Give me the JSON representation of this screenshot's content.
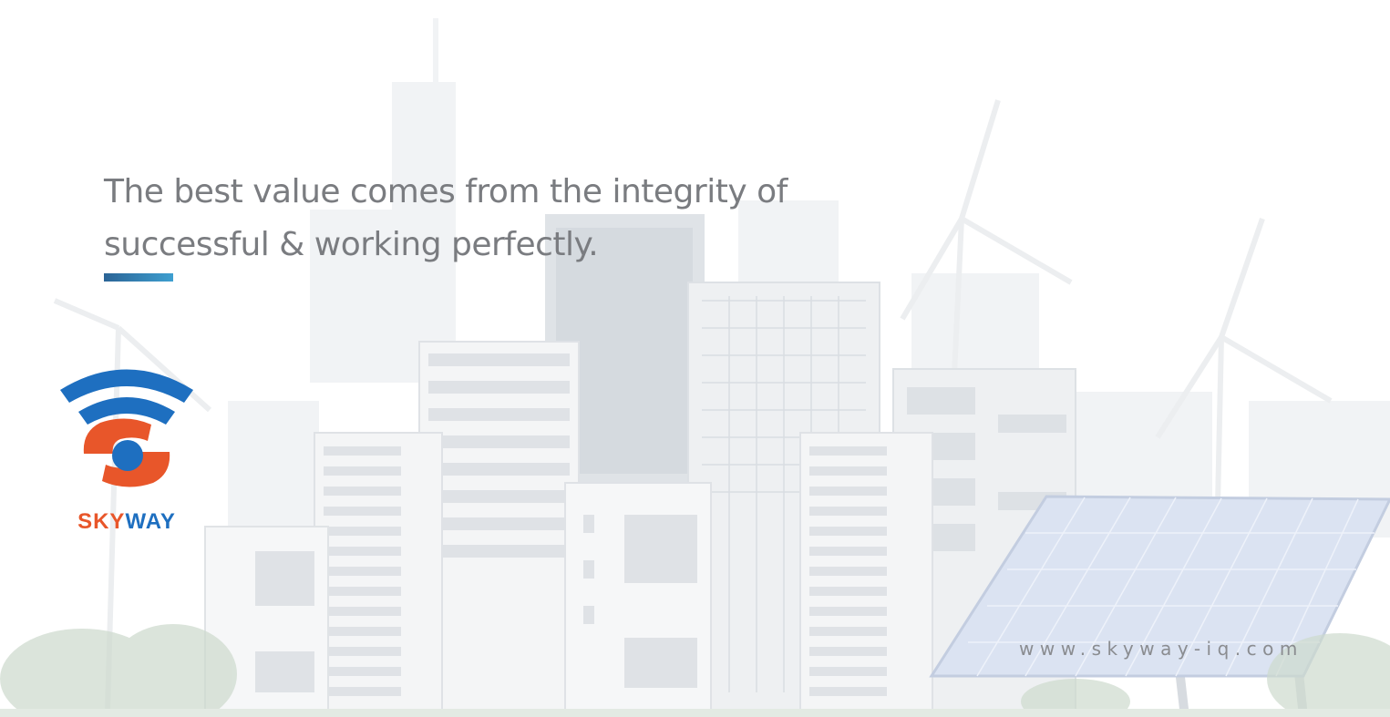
{
  "hero": {
    "tagline_line1": "The best value comes from the integrity of",
    "tagline_line2": "successful & working perfectly.",
    "accent_gradient": [
      "#2b6496",
      "#3e9fd0"
    ]
  },
  "logo": {
    "wordmark": "SKYWAY",
    "colors": {
      "blue": "#1e6fc0",
      "orange": "#e8562a"
    }
  },
  "footer": {
    "website": "www.skyway-iq.com"
  },
  "background": {
    "illustration": "city-skyline-wind-turbines-solar-panel",
    "colors": {
      "building": "#e9ecef",
      "building_dark": "#d9dde2",
      "window": "#cfd4da",
      "greenery": "#c9d8c9",
      "solar": "#d5dff0"
    }
  }
}
